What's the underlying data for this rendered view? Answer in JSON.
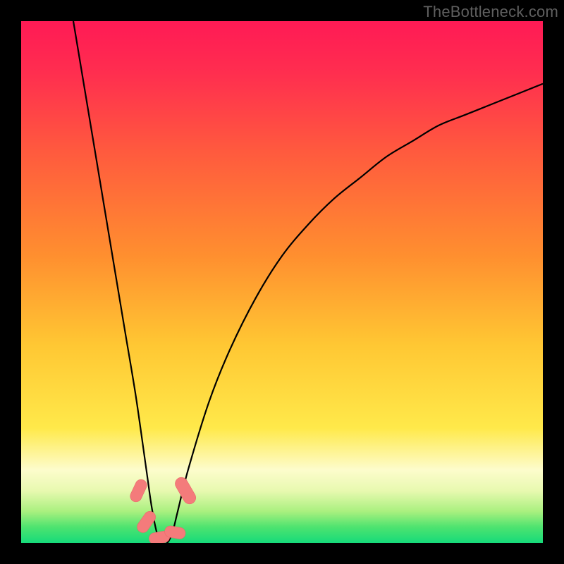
{
  "watermark": "TheBottleneck.com",
  "colors": {
    "frame": "#000000",
    "curve": "#000000",
    "marker_fill": "#f47b7b",
    "marker_stroke": "#e86a6a",
    "gradient_stops": [
      {
        "offset": 0.0,
        "color": "#ff1a55"
      },
      {
        "offset": 0.1,
        "color": "#ff2e4f"
      },
      {
        "offset": 0.25,
        "color": "#ff5a3e"
      },
      {
        "offset": 0.45,
        "color": "#ff8f2f"
      },
      {
        "offset": 0.62,
        "color": "#ffc733"
      },
      {
        "offset": 0.78,
        "color": "#ffe94a"
      },
      {
        "offset": 0.86,
        "color": "#fdfccc"
      },
      {
        "offset": 0.9,
        "color": "#e8f9b0"
      },
      {
        "offset": 0.94,
        "color": "#a9f07f"
      },
      {
        "offset": 0.97,
        "color": "#4de36f"
      },
      {
        "offset": 1.0,
        "color": "#16db7a"
      }
    ]
  },
  "chart_data": {
    "type": "line",
    "title": "",
    "xlabel": "",
    "ylabel": "",
    "xlim": [
      0,
      100
    ],
    "ylim": [
      0,
      100
    ],
    "grid": false,
    "legend": false,
    "description": "Bottleneck-style V-shaped curve over vertical rainbow heat gradient. Minimum near x≈27 at y≈0; curve rises steeply to y=100 on left side near x≈10 and rises with decreasing slope to y≈88 at x=100 on right side.",
    "series": [
      {
        "name": "bottleneck-curve",
        "x": [
          10,
          12,
          14,
          16,
          18,
          20,
          22,
          24,
          25,
          26,
          27,
          28,
          29,
          30,
          32,
          36,
          40,
          45,
          50,
          55,
          60,
          65,
          70,
          75,
          80,
          85,
          90,
          95,
          100
        ],
        "values": [
          100,
          88,
          76,
          64,
          52,
          40,
          28,
          14,
          7,
          2,
          0,
          0,
          2,
          6,
          14,
          27,
          37,
          47,
          55,
          61,
          66,
          70,
          74,
          77,
          80,
          82,
          84,
          86,
          88
        ]
      }
    ],
    "markers": [
      {
        "x": 22.5,
        "y": 10,
        "w": 2.2,
        "h": 4.5,
        "rot": 25
      },
      {
        "x": 24.0,
        "y": 4,
        "w": 2.2,
        "h": 4.5,
        "rot": 35
      },
      {
        "x": 26.5,
        "y": 1,
        "w": 2.2,
        "h": 4.0,
        "rot": 80
      },
      {
        "x": 29.5,
        "y": 2,
        "w": 2.2,
        "h": 4.0,
        "rot": 100
      },
      {
        "x": 31.5,
        "y": 10,
        "w": 2.4,
        "h": 5.5,
        "rot": -30
      }
    ]
  }
}
